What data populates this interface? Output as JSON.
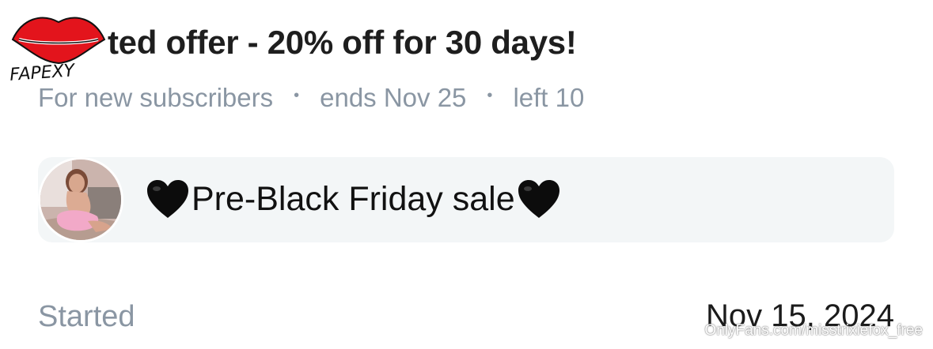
{
  "offer": {
    "title": "ted offer - 20% off for 30 days!",
    "audience": "For new subscribers",
    "separator": "•",
    "ends": "ends Nov 25",
    "left": "left 10"
  },
  "campaign": {
    "message": "Pre-Black Friday sale",
    "heart_icon": "black-heart-icon"
  },
  "started": {
    "label": "Started",
    "date": "Nov 15, 2024"
  },
  "logo": {
    "text": "FAPEXY"
  },
  "watermark": {
    "text": "OnlyFans.com/misstrixiefox_free"
  },
  "colors": {
    "title": "#1e1e1e",
    "muted": "#8a96a3",
    "campaign_bg": "#f3f6f7",
    "logo_red": "#e3141c"
  }
}
